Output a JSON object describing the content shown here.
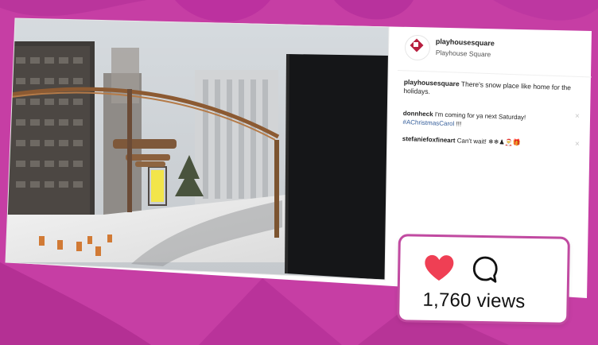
{
  "post": {
    "username": "playhousesquare",
    "location": "Playhouse Square",
    "caption_user": "playhousesquare",
    "caption_text": " There's snow place like home for the holidays.",
    "comments": [
      {
        "user": "donnheck",
        "text": " I'm coming for ya next Saturday! ",
        "tag": "#AChristmasCarol",
        "suffix": " !!!"
      },
      {
        "user": "stefaniefoxfineart",
        "text": " Can't wait! ❄❄♟🎅🎁",
        "tag": "",
        "suffix": ""
      }
    ]
  },
  "stats": {
    "views": "1,760 views"
  },
  "icons": [
    "heart-icon",
    "comment-icon",
    "close-icon"
  ],
  "colors": {
    "background": "#c43aa6",
    "heart": "#ef3f54",
    "card_border": "#c14aa1"
  }
}
